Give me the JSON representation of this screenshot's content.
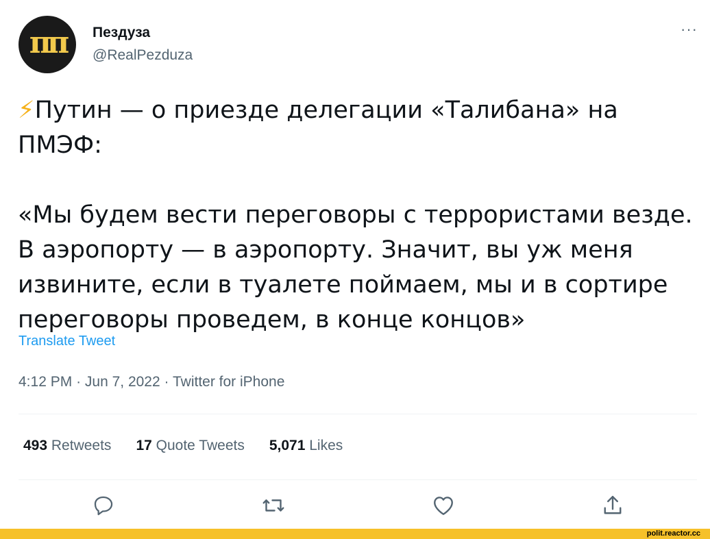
{
  "author": {
    "avatar_glyph": "п",
    "display_name": "Пездуза",
    "handle": "@RealPezduza"
  },
  "more_label": "···",
  "tweet": {
    "emoji": "⚡",
    "text": "Путин — о приезде делегации «Талибана» на\nПМЭФ:\n\n«Мы будем вести переговоры с террористами везде.\nВ аэропорту — в аэропорту. Значит, вы уж меня\nизвините, если в туалете поймаем, мы и в сортире\nпереговоры проведем, в конце концов»"
  },
  "translate_label": "Translate Tweet",
  "meta": {
    "time": "4:12 PM",
    "date": "Jun 7, 2022",
    "source": "Twitter for iPhone",
    "separator": "·"
  },
  "stats": [
    {
      "count": "493",
      "label": "Retweets"
    },
    {
      "count": "17",
      "label": "Quote Tweets"
    },
    {
      "count": "5,071",
      "label": "Likes"
    }
  ],
  "actions": [
    {
      "name": "reply",
      "icon": "reply-icon"
    },
    {
      "name": "retweet",
      "icon": "retweet-icon"
    },
    {
      "name": "like",
      "icon": "heart-icon"
    },
    {
      "name": "share",
      "icon": "share-icon"
    }
  ],
  "colors": {
    "accent": "#1d9bf0",
    "muted": "#536471",
    "text": "#0f1419",
    "watermark_bar": "#f6c12a"
  },
  "watermark": "polit.reactor.cc"
}
